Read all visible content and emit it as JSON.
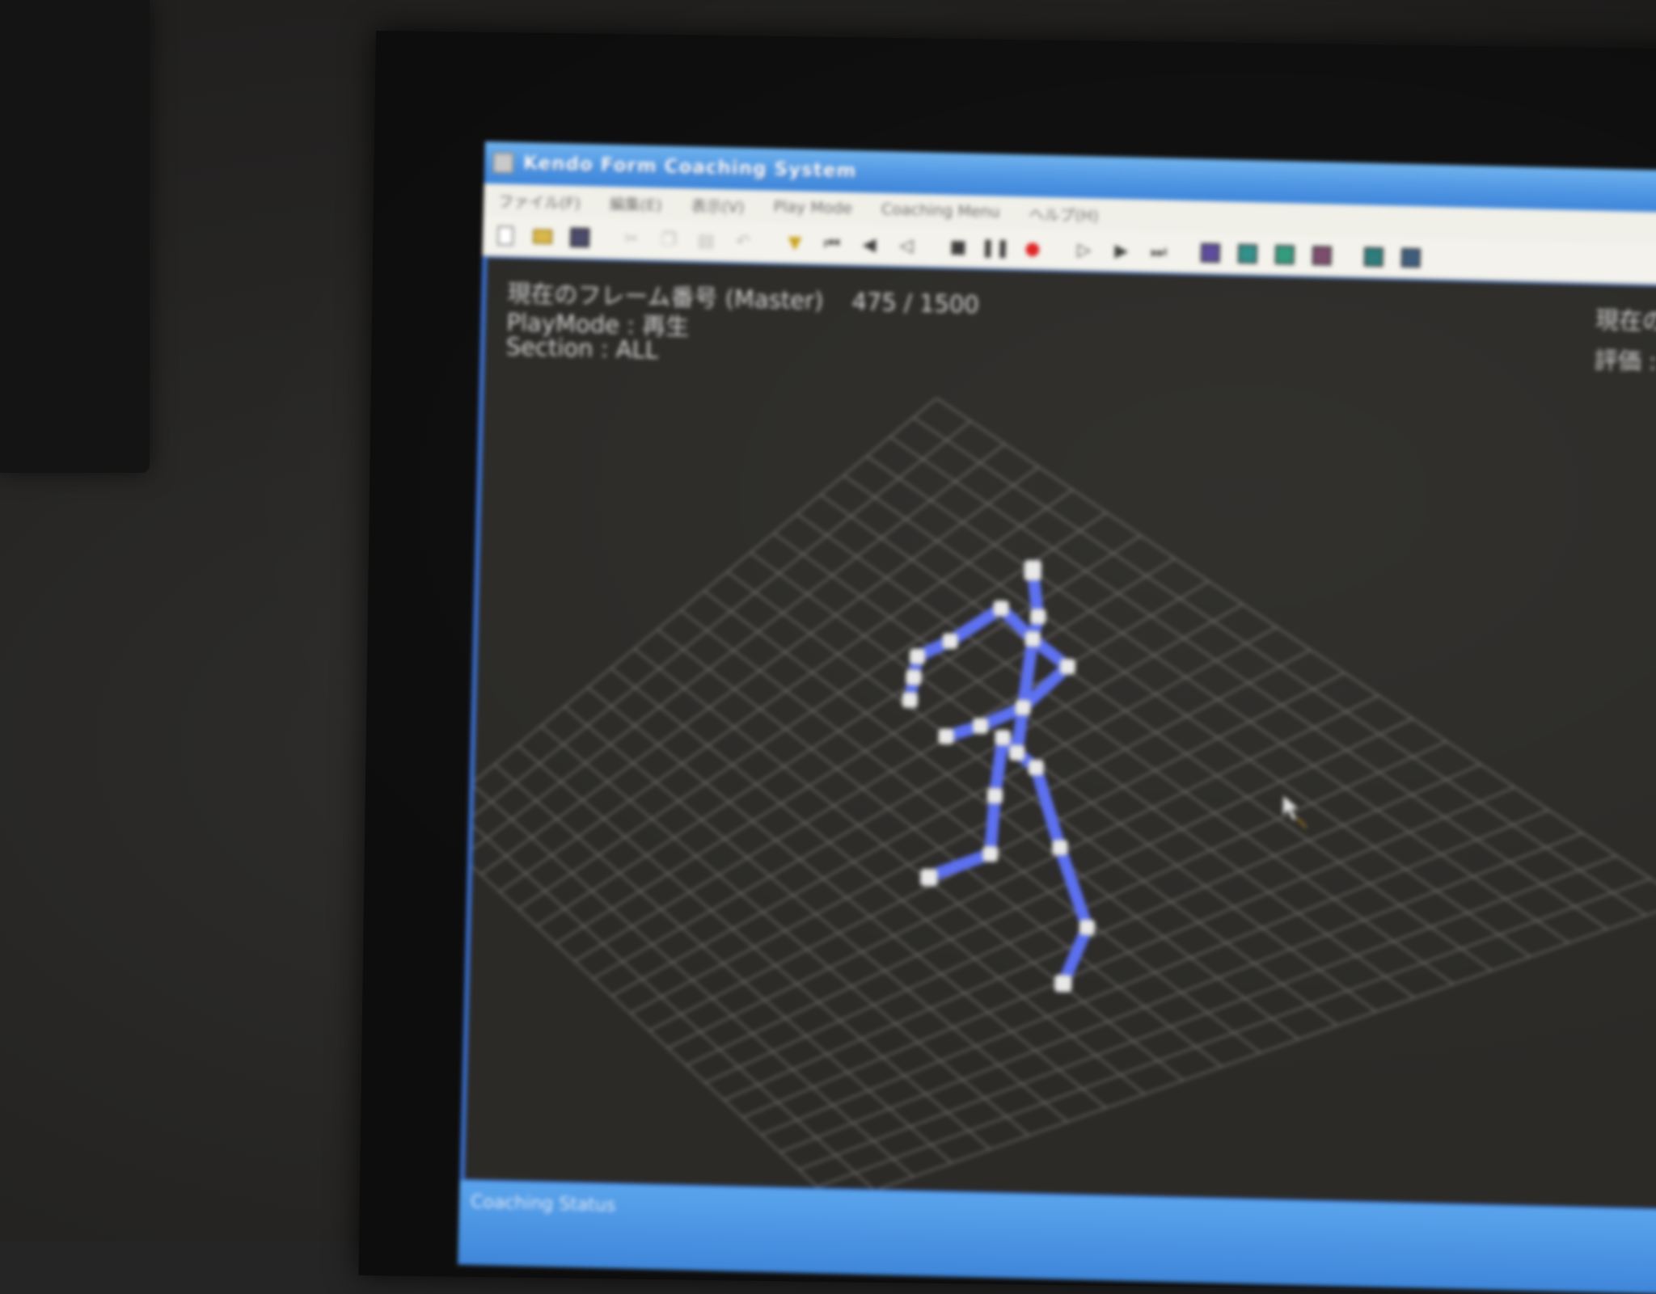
{
  "window": {
    "title": "Kendo Form Coaching System"
  },
  "menu": {
    "items": [
      "ファイル(F)",
      "編集(E)",
      "表示(V)",
      "Play Mode",
      "Coaching Menu",
      "ヘルプ(H)"
    ]
  },
  "toolbar": {
    "icons": [
      "new-file-icon",
      "open-folder-icon",
      "save-icon",
      "cut-icon",
      "copy-icon",
      "paste-icon",
      "undo-icon",
      "marker-icon",
      "skip-back-icon",
      "step-back-icon",
      "frame-back-icon",
      "stop-icon",
      "pause-icon",
      "record-icon",
      "frame-forward-icon",
      "play-icon",
      "skip-forward-icon",
      "view-front-icon",
      "view-side-icon",
      "view-top-icon",
      "view-3d-icon",
      "camera-1-icon",
      "camera-2-icon"
    ]
  },
  "viewport": {
    "frame_label": "現在のフレーム番号 (Master)",
    "frame_value": "475 / 1500",
    "playmode_label": "PlayMode : 再生",
    "section_label": "Section : ALL",
    "right_label_1": "現在のフ",
    "right_label_2": "評価 :"
  },
  "status": {
    "text": "Coaching Status"
  },
  "colors": {
    "skeleton_bone": "#5a6ef0",
    "skeleton_joint": "#e8e8e8",
    "grid_line": "#6a6866",
    "viewport_bg": "#2b2a27",
    "title_bar": "#4b93e2"
  }
}
